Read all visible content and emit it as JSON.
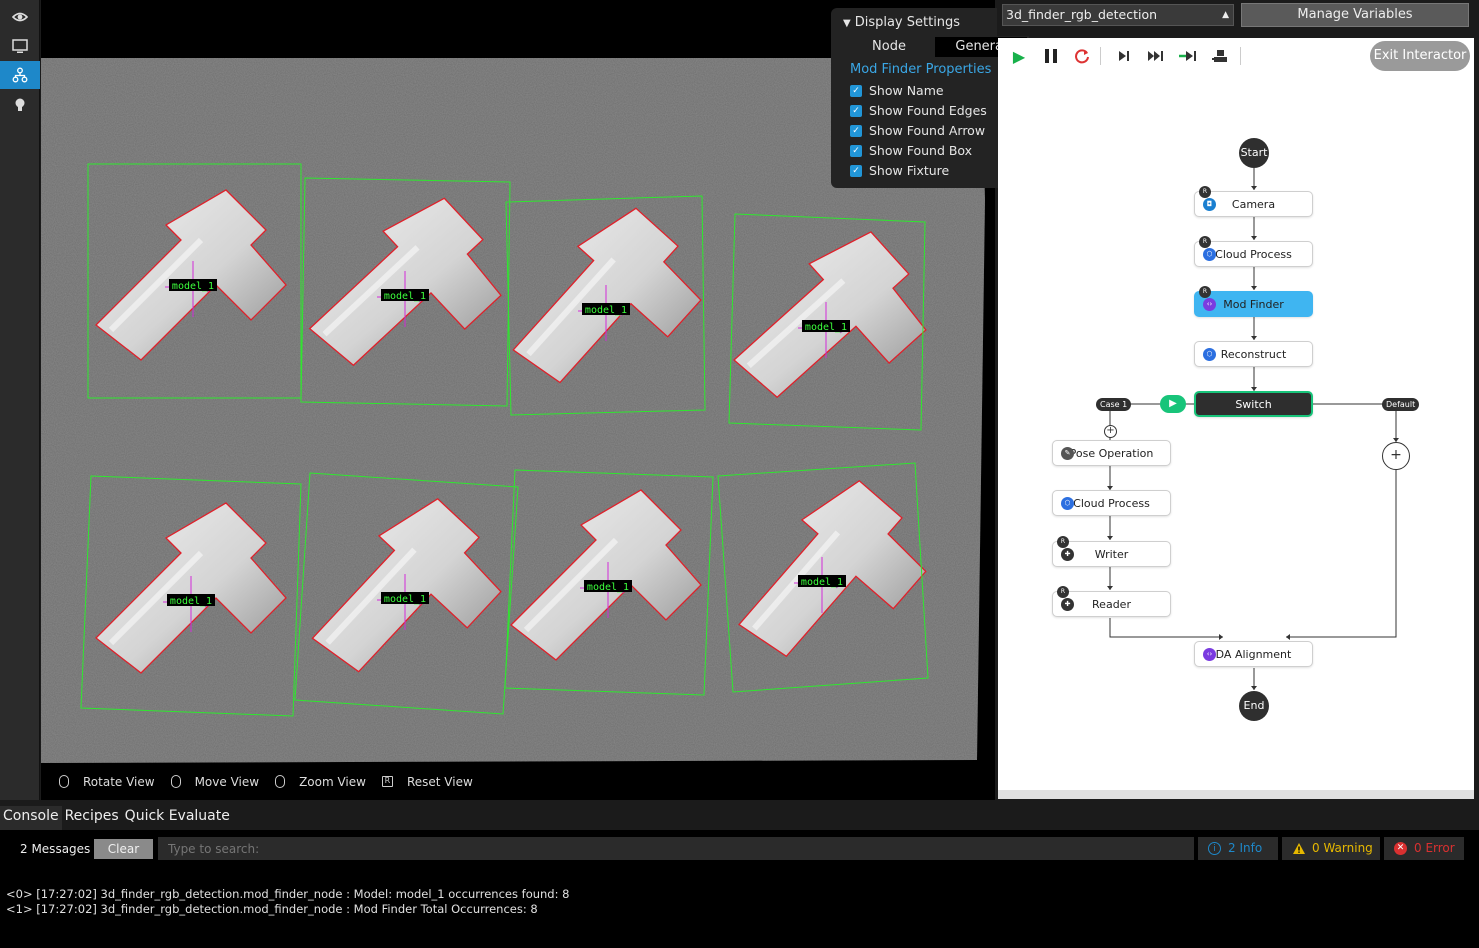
{
  "rail": {
    "items": [
      {
        "icon": "eye-icon"
      },
      {
        "icon": "monitor-icon"
      },
      {
        "icon": "flow-graph-icon",
        "active": true
      },
      {
        "icon": "lightbulb-icon"
      }
    ]
  },
  "viewport": {
    "labels": [
      "model_1",
      "model_1",
      "model_1",
      "model_1",
      "model_1",
      "model_1",
      "model_1",
      "model_1"
    ],
    "toolbar": {
      "rotate": "Rotate View",
      "move": "Move View",
      "zoom": "Zoom View",
      "reset": "Reset View",
      "reset_key": "R"
    }
  },
  "display_settings": {
    "title": "Display Settings",
    "tabs": {
      "node": "Node",
      "general": "General"
    },
    "section": "Mod Finder Properties",
    "options": [
      "Show Name",
      "Show Found Edges",
      "Show Found Arrow",
      "Show Found Box",
      "Show Fixture"
    ]
  },
  "header": {
    "flow_name": "3d_finder_rgb_detection",
    "manage_variables": "Manage Variables"
  },
  "flow": {
    "exit_label": "Exit Interactor",
    "start": "Start",
    "end": "End",
    "nodes": {
      "camera": "Camera",
      "cloud_process": "Cloud Process",
      "mod_finder": "Mod Finder",
      "reconstruct": "Reconstruct",
      "switch": "Switch",
      "pose_operation": "Pose Operation",
      "cloud_process_2": "Cloud Process",
      "writer": "Writer",
      "reader": "Reader",
      "da_alignment": "DA Alignment"
    },
    "case_label": "Case 1",
    "default_label": "Default",
    "r_badge": "R",
    "plus": "+"
  },
  "bottom": {
    "tabs": [
      "Console",
      "Recipes",
      "Quick Evaluate"
    ],
    "messages_count": "2 Messages",
    "clear": "Clear",
    "search_placeholder": "Type to search:",
    "info": "2 Info",
    "warning": "0 Warning",
    "error": "0 Error",
    "log": [
      "<0> [17:27:02] 3d_finder_rgb_detection.mod_finder_node : Model: model_1 occurrences found: 8",
      "<1> [17:27:02] 3d_finder_rgb_detection.mod_finder_node : Mod Finder Total Occurrences: 8"
    ]
  },
  "colors": {
    "accent": "#1e88c9",
    "active_node": "#3fb5f1",
    "switch_border": "#18c47a",
    "found_box": "#2ee82e",
    "found_edge": "#e0202a",
    "arrow": "#d22bd8",
    "label_text": "#3cff3c",
    "info": "#1e88c9",
    "warning": "#e6b800",
    "error": "#d93030"
  }
}
